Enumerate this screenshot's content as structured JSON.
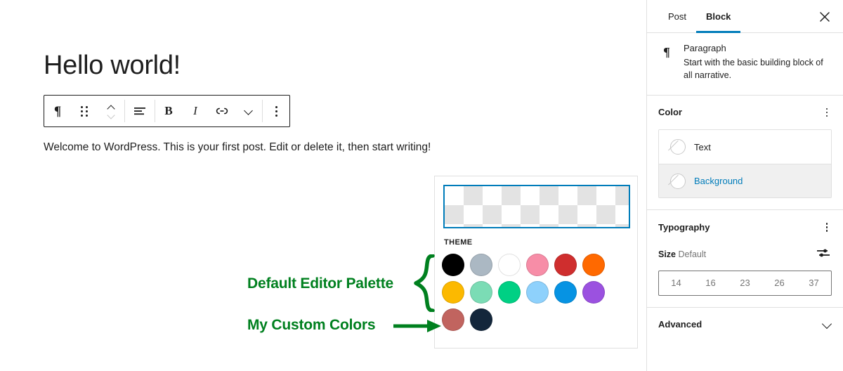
{
  "editor": {
    "post_title": "Hello world!",
    "post_body": "Welcome to WordPress. This is your first post. Edit or delete it, then start writing!",
    "toolbar": {
      "block_type_icon": "¶",
      "block_type_label": "Paragraph",
      "drag_handle_label": "Drag",
      "move_up_label": "Move up",
      "move_down_label": "Move down",
      "align_label": "Align text",
      "bold_label": "B",
      "italic_label": "I",
      "link_label": "Link",
      "more_rich_text_label": "More",
      "options_label": "Options"
    }
  },
  "color_popover": {
    "preview_label": "Transparent",
    "palette_heading": "THEME",
    "rows": [
      [
        {
          "name": "black",
          "hex": "#000000"
        },
        {
          "name": "cyan-bluish-gray",
          "hex": "#abb8c3"
        },
        {
          "name": "white",
          "hex": "#ffffff"
        },
        {
          "name": "pale-pink",
          "hex": "#f78da7"
        },
        {
          "name": "vivid-red",
          "hex": "#cf2e2e"
        },
        {
          "name": "luminous-vivid-orange",
          "hex": "#ff6900"
        }
      ],
      [
        {
          "name": "luminous-vivid-amber",
          "hex": "#fcb900"
        },
        {
          "name": "light-green-cyan",
          "hex": "#7bdcb5"
        },
        {
          "name": "vivid-green-cyan",
          "hex": "#00d084"
        },
        {
          "name": "pale-cyan-blue",
          "hex": "#8ed1fc"
        },
        {
          "name": "vivid-cyan-blue",
          "hex": "#0693e3"
        },
        {
          "name": "vivid-purple",
          "hex": "#9b51e0"
        }
      ],
      [
        {
          "name": "custom-brick",
          "hex": "#c1645f"
        },
        {
          "name": "custom-navy",
          "hex": "#13263b"
        }
      ]
    ]
  },
  "annotations": {
    "accent_color": "#00801f",
    "palette_note": "Default Editor Palette",
    "custom_note": "My Custom Colors"
  },
  "sidebar": {
    "tabs": [
      {
        "label": "Post",
        "active": false
      },
      {
        "label": "Block",
        "active": true
      }
    ],
    "close_label": "Close settings",
    "block": {
      "icon": "¶",
      "title": "Paragraph",
      "description": "Start with the basic building block of all narrative."
    },
    "color_section": {
      "title": "Color",
      "options_label": "Color options",
      "items": [
        {
          "label": "Text",
          "selected": false
        },
        {
          "label": "Background",
          "selected": true
        }
      ]
    },
    "typography_section": {
      "title": "Typography",
      "options_label": "Typography options",
      "size_label": "Size",
      "size_value": "Default",
      "custom_size_label": "Set custom size",
      "sizes": [
        "14",
        "16",
        "23",
        "26",
        "37"
      ]
    },
    "advanced_section": {
      "title": "Advanced"
    }
  }
}
